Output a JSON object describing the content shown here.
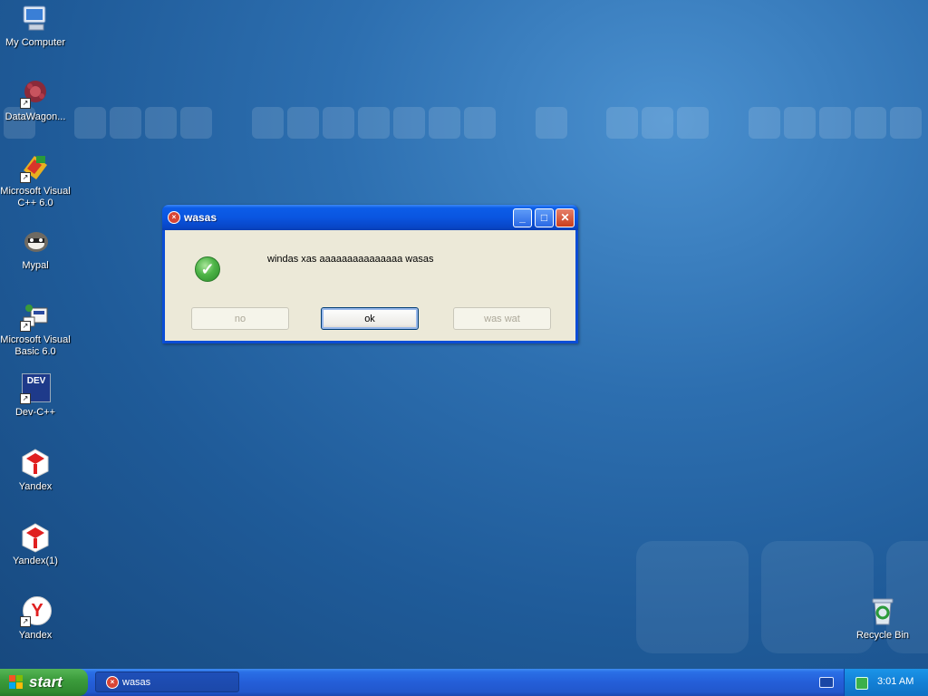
{
  "desktop": {
    "icons": [
      {
        "label": "My Computer",
        "icon": "my-computer-icon"
      },
      {
        "label": "DataWagon...",
        "icon": "datawagon-icon"
      },
      {
        "label": "Microsoft Visual C++ 6.0",
        "icon": "visual-cpp-icon"
      },
      {
        "label": "Mypal",
        "icon": "mypal-icon"
      },
      {
        "label": "Microsoft Visual Basic 6.0",
        "icon": "visual-basic-icon"
      },
      {
        "label": "Dev-C++",
        "icon": "dev-cpp-icon",
        "badge": "DEV"
      },
      {
        "label": "Yandex",
        "icon": "yandex-icon"
      },
      {
        "label": "Yandex(1)",
        "icon": "yandex-icon"
      },
      {
        "label": "Yandex",
        "icon": "yandex-browser-icon",
        "glyph": "Y"
      },
      {
        "label": "Recycle Bin",
        "icon": "recycle-bin-icon"
      }
    ]
  },
  "dialog": {
    "title": "wasas",
    "message": "windas xas aaaaaaaaaaaaaaa wasas",
    "buttons": {
      "no": "no",
      "ok": "ok",
      "was_wat": "was wat"
    },
    "status_icon": "success-check-icon"
  },
  "taskbar": {
    "start_label": "start",
    "task_label": "wasas",
    "clock": "3:01 AM"
  },
  "colors": {
    "titlebar": "#0a55e0",
    "start_button": "#3c9c3c",
    "taskbar": "#245ed8",
    "dialog_body": "#ece9d8"
  }
}
